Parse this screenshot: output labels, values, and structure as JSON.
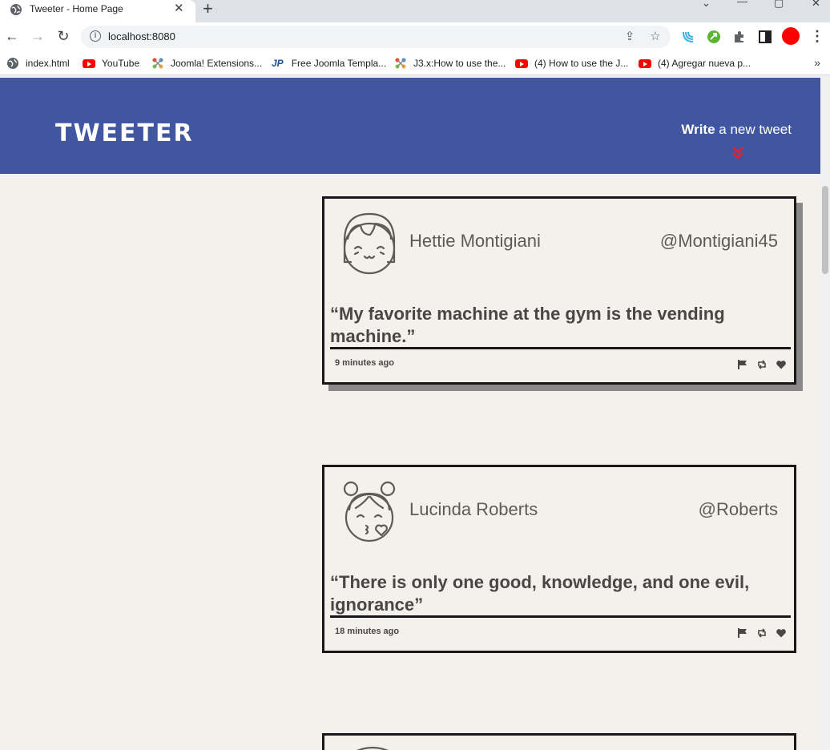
{
  "browser": {
    "tab_title": "Tweeter - Home Page",
    "url": "localhost:8080",
    "bookmarks": [
      {
        "label": "index.html",
        "icon": "globe-icon"
      },
      {
        "label": "YouTube",
        "icon": "youtube-icon"
      },
      {
        "label": "Joomla! Extensions...",
        "icon": "joomla-icon"
      },
      {
        "label": "Free Joomla Templa...",
        "icon": "jp-icon"
      },
      {
        "label": "J3.x:How to use the...",
        "icon": "joomla-icon"
      },
      {
        "label": "(4) How to use the J...",
        "icon": "youtube-icon"
      },
      {
        "label": "(4) Agregar nueva p...",
        "icon": "youtube-icon"
      }
    ],
    "jp_text": "JP",
    "bookmarks_more": "»"
  },
  "header": {
    "logo": "TWEETER",
    "write_bold": "Write",
    "write_rest": " a new tweet",
    "accent_color": "#e8202a",
    "bg_color": "#4156a1"
  },
  "tweets": [
    {
      "name": "Hettie Montigiani",
      "handle": "@Montigiani45",
      "text": "“My favorite machine at the gym is the vending machine.”",
      "time": "9 minutes ago",
      "avatar": "girl-bangs-avatar-icon"
    },
    {
      "name": "Lucinda Roberts",
      "handle": "@Roberts",
      "text": "“There is only one good, knowledge, and one evil, ignorance”",
      "time": "18 minutes ago",
      "avatar": "girl-buns-kiss-avatar-icon"
    }
  ]
}
